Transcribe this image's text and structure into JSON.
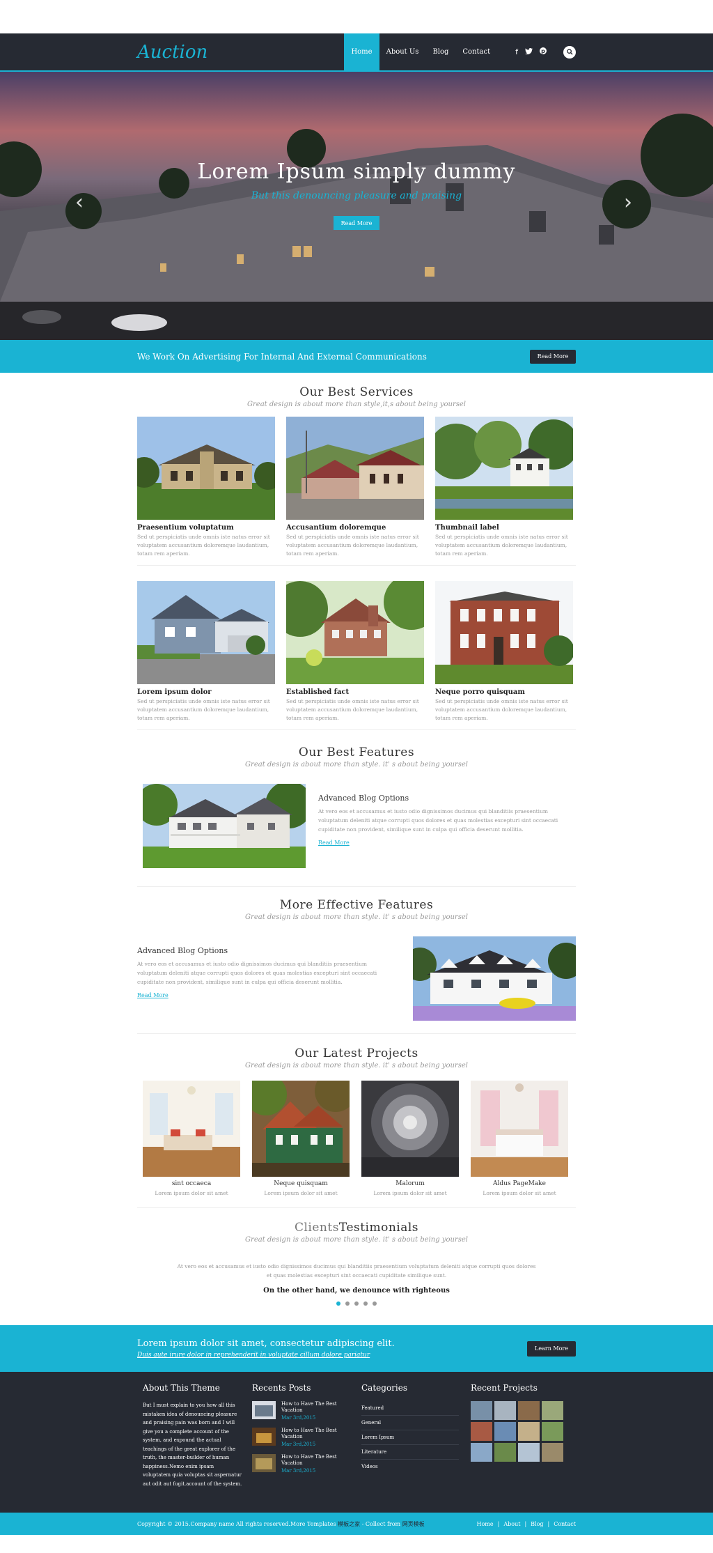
{
  "header": {
    "logo": "Auction",
    "nav": [
      "Home",
      "About Us",
      "Blog",
      "Contact"
    ],
    "social_icons": [
      "facebook-icon",
      "twitter-icon",
      "pinterest-icon"
    ]
  },
  "hero": {
    "title": "Lorem Ipsum simply dummy",
    "subtitle": "But this denouncing pleasure and praising",
    "button": "Read More"
  },
  "banner": {
    "text": "We Work On Advertising For Internal And External Communications",
    "button": "Read More"
  },
  "services": {
    "title": "Our Best Services",
    "subtitle": "Great design is about more than style,it,s about being yoursel",
    "items": [
      {
        "title": "Praesentium voluptatum",
        "text": "Sed ut perspiciatis unde omnis iste natus error sit voluptatem accusantium doloremque laudantium, totam rem aperiam."
      },
      {
        "title": "Accusantium doloremque",
        "text": "Sed ut perspiciatis unde omnis iste natus error sit voluptatem accusantium doloremque laudantium, totam rem aperiam."
      },
      {
        "title": "Thumbnail label",
        "text": "Sed ut perspiciatis unde omnis iste natus error sit voluptatem accusantium doloremque laudantium, totam rem aperiam."
      },
      {
        "title": "Lorem ipsum dolor",
        "text": "Sed ut perspiciatis unde omnis iste natus error sit voluptatem accusantium doloremque laudantium, totam rem aperiam."
      },
      {
        "title": "Established fact",
        "text": "Sed ut perspiciatis unde omnis iste natus error sit voluptatem accusantium doloremque laudantium, totam rem aperiam."
      },
      {
        "title": "Neque porro quisquam",
        "text": "Sed ut perspiciatis unde omnis iste natus error sit voluptatem accusantium doloremque laudantium, totam rem aperiam."
      }
    ]
  },
  "features": {
    "title": "Our Best Features",
    "subtitle": "Great design is about more than style. it' s about being yoursel",
    "heading": "Advanced Blog Options",
    "text": "At vero eos et accusamus et iusto odio dignissimos ducimus qui blanditiis praesentium voluptatum deleniti atque corrupti quos dolores et quas molestias excepturi sint occaecati cupiditate non provident, similique sunt in culpa qui officia deserunt mollitia.",
    "link": "Read More"
  },
  "more_features": {
    "title": "More Effective Features",
    "subtitle": "Great design is about more than style. it' s about being yoursel",
    "heading": "Advanced Blog Options",
    "text": "At vero eos et accusamus et iusto odio dignissimos ducimus qui blanditiis praesentium voluptatum deleniti atque corrupti quos dolores et quas molestias excepturi sint occaecati cupiditate non provident, similique sunt in culpa qui officia deserunt mollitia.",
    "link": "Read More"
  },
  "projects": {
    "title": "Our Latest Projects",
    "subtitle": "Great design is about more than style. it' s about being yoursel",
    "items": [
      {
        "name": "sint occaeca",
        "text": "Lorem ipsum dolor sit amet"
      },
      {
        "name": "Neque quisquam",
        "text": "Lorem ipsum dolor sit amet"
      },
      {
        "name": "Malorum",
        "text": "Lorem ipsum dolor sit amet"
      },
      {
        "name": "Aldus PageMake",
        "text": "Lorem ipsum dolor sit amet"
      }
    ]
  },
  "testimonials": {
    "title_a": "Clients",
    "title_b": "Testimonials",
    "subtitle": "Great design is about more than style. it' s about being yoursel",
    "body": "At vero eos et accusamus et iusto odio dignissimos ducimus qui blanditiis praesentium voluptatum deleniti atque corrupti quos dolores et quas molestias excepturi sint occaecati cupiditate similique sunt.",
    "quote": "On the other hand, we denounce with righteous"
  },
  "cta": {
    "title": "Lorem ipsum dolor sit amet, consectetur adipiscing elit.",
    "subtitle": "Duis aute irure dolor in reprehenderit in voluptate cillum dolore pariatur",
    "button": "Learn More"
  },
  "footer": {
    "about_title": "About This Theme",
    "about_text": "But I must explain to you how all this mistaken idea of denouncing pleasure and praising pain was born and I will give you a complete account of the system, and expound the actual teachings of the great explorer of the truth, the master-builder of human happiness.Nemo enim ipsam voluptatem quia voluptas sit aspernatur aut odit aut fugit.account of the system.",
    "posts_title": "Recents Posts",
    "posts": [
      {
        "title": "How to Have The Best Vacation",
        "date": "Mar 3rd,2015"
      },
      {
        "title": "How to Have The Best Vacation",
        "date": "Mar 3rd,2015"
      },
      {
        "title": "How to Have The Best Vacation",
        "date": "Mar 3rd,2015"
      }
    ],
    "categories_title": "Categories",
    "categories": [
      "Featured",
      "General",
      "Lorem Ipsum",
      "Literature",
      "Videos"
    ],
    "projects_title": "Recent Projects"
  },
  "bottom": {
    "copyright": "Copyright © 2015.Company name All rights reserved.More Templates ",
    "site1": "模板之家",
    "mid": " - Collect from ",
    "site2": "网页模板",
    "links": [
      "Home",
      "About",
      "Blog",
      "Contact"
    ]
  },
  "colors": {
    "accent": "#1ab3d3",
    "dark": "#262a33"
  }
}
